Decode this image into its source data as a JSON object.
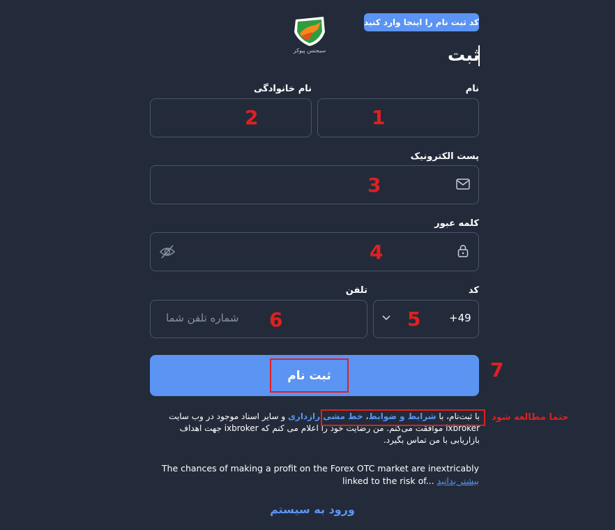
{
  "promo": {
    "label": "کد ثبت نام را اینجا وارد کنید"
  },
  "logo": {
    "text": "سیجنس پیوکر"
  },
  "page": {
    "title": "ثبت"
  },
  "form": {
    "first_name": {
      "label": "نام",
      "marker": "1"
    },
    "last_name": {
      "label": "نام خانوادگی",
      "marker": "2"
    },
    "email": {
      "label": "پست الکترونیک",
      "marker": "3",
      "icon": "envelope-icon"
    },
    "password": {
      "label": "کلمه عبور",
      "marker": "4",
      "icon": "lock-icon",
      "toggle_icon": "eye-off-icon"
    },
    "code": {
      "label": "کد",
      "value": "+49",
      "marker": "5",
      "icon": "chevron-down-icon"
    },
    "phone": {
      "label": "تلفن",
      "placeholder": "شماره تلفن شما",
      "marker": "6"
    }
  },
  "submit": {
    "label": "ثبت نام",
    "marker": "7"
  },
  "terms": {
    "prefix": "با ثبت‌نام، با ",
    "link_terms": "شرایط و ضوابط",
    "separator": "، ",
    "link_privacy": "خط مشی رازداری",
    "suffix": " و سایر اسناد موجود در وب سایت ixbroker موافقت می‌کنم. من رضایت خود را اعلام می کنم که ixbroker جهت اهداف بازاریابی با من تماس بگیرد.",
    "annotation": "حتما مطالعه شود"
  },
  "risk": {
    "text": "The chances of making a profit on the Forex OTC market are inextricably linked to the risk of...",
    "more_link": "بیشتر بدانید"
  },
  "login": {
    "label": "ورود به سیستم"
  },
  "colors": {
    "background": "#232b3a",
    "accent": "#5b94f2",
    "annotation_red": "#e02020",
    "field_border": "#4a5466"
  }
}
